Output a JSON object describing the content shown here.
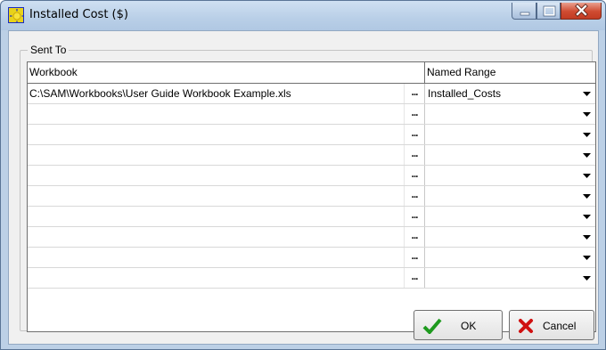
{
  "window": {
    "title": "Installed Cost ($)",
    "icon": "sun-icon"
  },
  "group": {
    "label": "Sent To"
  },
  "table": {
    "columns": [
      "Workbook",
      "Named Range"
    ],
    "browse_label": "...",
    "rows": [
      {
        "workbook": "C:\\SAM\\Workbooks\\User Guide Workbook Example.xls",
        "named_range": "Installed_Costs"
      },
      {
        "workbook": "",
        "named_range": ""
      },
      {
        "workbook": "",
        "named_range": ""
      },
      {
        "workbook": "",
        "named_range": ""
      },
      {
        "workbook": "",
        "named_range": ""
      },
      {
        "workbook": "",
        "named_range": ""
      },
      {
        "workbook": "",
        "named_range": ""
      },
      {
        "workbook": "",
        "named_range": ""
      },
      {
        "workbook": "",
        "named_range": ""
      },
      {
        "workbook": "",
        "named_range": ""
      }
    ]
  },
  "buttons": {
    "ok_label": "OK",
    "cancel_label": "Cancel"
  },
  "colors": {
    "ok_check": "#1e9a1e",
    "cancel_x": "#d01010",
    "close_button": "#c9442b"
  }
}
